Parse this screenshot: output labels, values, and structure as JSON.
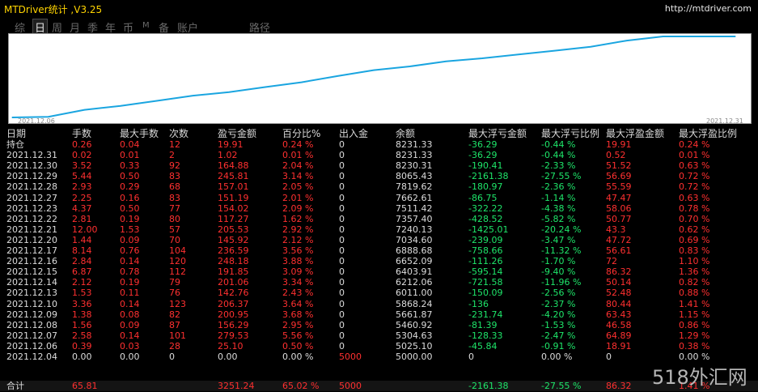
{
  "window": {
    "title": "MTDriver统计 ,V3.25",
    "url": "http://mtdriver.com"
  },
  "tabs": [
    {
      "label": "综",
      "active": false
    },
    {
      "label": "日",
      "active": true
    },
    {
      "label": "周",
      "active": false
    },
    {
      "label": "月",
      "active": false
    },
    {
      "label": "季",
      "active": false
    },
    {
      "label": "年",
      "active": false
    },
    {
      "label": "币",
      "active": false
    },
    {
      "label": "M",
      "active": false
    },
    {
      "label": "备",
      "active": false
    },
    {
      "label": "账户",
      "active": false
    },
    {
      "label": "路径",
      "active": false
    }
  ],
  "chart_data": {
    "type": "line",
    "x_start_label": "2021.12.06",
    "x_end_label": "2021.12.31",
    "line_color": "#1aa5e0",
    "series": [
      {
        "x": [
          "2021.12.04",
          "2021.12.06",
          "2021.12.07",
          "2021.12.08",
          "2021.12.09",
          "2021.12.10",
          "2021.12.13",
          "2021.12.14",
          "2021.12.15",
          "2021.12.16",
          "2021.12.17",
          "2021.12.20",
          "2021.12.21",
          "2021.12.22",
          "2021.12.23",
          "2021.12.27",
          "2021.12.28",
          "2021.12.29",
          "2021.12.30",
          "2021.12.31",
          "持仓"
        ],
        "values": [
          5000.0,
          5025.1,
          5304.63,
          5460.92,
          5661.87,
          5868.24,
          6011.0,
          6212.06,
          6403.91,
          6652.09,
          6888.68,
          7034.6,
          7240.13,
          7357.4,
          7511.42,
          7662.61,
          7819.62,
          8065.43,
          8230.31,
          8231.33,
          8231.33
        ]
      }
    ]
  },
  "columns": [
    "日期",
    "手数",
    "最大手数",
    "次数",
    "盈亏金额",
    "百分比%",
    "出入金",
    "余额",
    "最大浮亏金额",
    "最大浮亏比例",
    "最大浮盈金额",
    "最大浮盈比例"
  ],
  "rows": [
    [
      "持仓",
      "0.26",
      "0.04",
      "12",
      "19.91",
      "0.24 %",
      "0",
      "8231.33",
      "-36.29",
      "-0.44 %",
      "19.91",
      "0.24 %"
    ],
    [
      "2021.12.31",
      "0.02",
      "0.01",
      "2",
      "1.02",
      "0.01 %",
      "0",
      "8231.33",
      "-36.29",
      "-0.44 %",
      "0.52",
      "0.01 %"
    ],
    [
      "2021.12.30",
      "3.52",
      "0.33",
      "92",
      "164.88",
      "2.04 %",
      "0",
      "8230.31",
      "-190.41",
      "-2.33 %",
      "51.52",
      "0.63 %"
    ],
    [
      "2021.12.29",
      "5.44",
      "0.50",
      "83",
      "245.81",
      "3.14 %",
      "0",
      "8065.43",
      "-2161.38",
      "-27.55 %",
      "56.69",
      "0.72 %"
    ],
    [
      "2021.12.28",
      "2.93",
      "0.29",
      "68",
      "157.01",
      "2.05 %",
      "0",
      "7819.62",
      "-180.97",
      "-2.36 %",
      "55.59",
      "0.72 %"
    ],
    [
      "2021.12.27",
      "2.25",
      "0.16",
      "83",
      "151.19",
      "2.01 %",
      "0",
      "7662.61",
      "-86.75",
      "-1.14 %",
      "47.47",
      "0.63 %"
    ],
    [
      "2021.12.23",
      "4.37",
      "0.50",
      "77",
      "154.02",
      "2.09 %",
      "0",
      "7511.42",
      "-322.22",
      "-4.38 %",
      "58.06",
      "0.78 %"
    ],
    [
      "2021.12.22",
      "2.81",
      "0.19",
      "80",
      "117.27",
      "1.62 %",
      "0",
      "7357.40",
      "-428.52",
      "-5.82 %",
      "50.77",
      "0.70 %"
    ],
    [
      "2021.12.21",
      "12.00",
      "1.53",
      "57",
      "205.53",
      "2.92 %",
      "0",
      "7240.13",
      "-1425.01",
      "-20.24 %",
      "43.3",
      "0.62 %"
    ],
    [
      "2021.12.20",
      "1.44",
      "0.09",
      "70",
      "145.92",
      "2.12 %",
      "0",
      "7034.60",
      "-239.09",
      "-3.47 %",
      "47.72",
      "0.69 %"
    ],
    [
      "2021.12.17",
      "8.14",
      "0.76",
      "104",
      "236.59",
      "3.56 %",
      "0",
      "6888.68",
      "-758.66",
      "-11.32 %",
      "56.61",
      "0.83 %"
    ],
    [
      "2021.12.16",
      "2.84",
      "0.14",
      "120",
      "248.18",
      "3.88 %",
      "0",
      "6652.09",
      "-111.26",
      "-1.70 %",
      "72",
      "1.10 %"
    ],
    [
      "2021.12.15",
      "6.87",
      "0.78",
      "112",
      "191.85",
      "3.09 %",
      "0",
      "6403.91",
      "-595.14",
      "-9.40 %",
      "86.32",
      "1.36 %"
    ],
    [
      "2021.12.14",
      "2.12",
      "0.19",
      "79",
      "201.06",
      "3.34 %",
      "0",
      "6212.06",
      "-721.58",
      "-11.96 %",
      "50.14",
      "0.82 %"
    ],
    [
      "2021.12.13",
      "1.53",
      "0.11",
      "76",
      "142.76",
      "2.43 %",
      "0",
      "6011.00",
      "-150.09",
      "-2.56 %",
      "52.48",
      "0.88 %"
    ],
    [
      "2021.12.10",
      "3.36",
      "0.14",
      "123",
      "206.37",
      "3.64 %",
      "0",
      "5868.24",
      "-136",
      "-2.37 %",
      "80.44",
      "1.41 %"
    ],
    [
      "2021.12.09",
      "1.38",
      "0.08",
      "82",
      "200.95",
      "3.68 %",
      "0",
      "5661.87",
      "-231.74",
      "-4.20 %",
      "63.43",
      "1.15 %"
    ],
    [
      "2021.12.08",
      "1.56",
      "0.09",
      "87",
      "156.29",
      "2.95 %",
      "0",
      "5460.92",
      "-81.39",
      "-1.53 %",
      "46.58",
      "0.86 %"
    ],
    [
      "2021.12.07",
      "2.58",
      "0.14",
      "101",
      "279.53",
      "5.56 %",
      "0",
      "5304.63",
      "-128.33",
      "-2.47 %",
      "64.89",
      "1.29 %"
    ],
    [
      "2021.12.06",
      "0.39",
      "0.03",
      "28",
      "25.10",
      "0.50 %",
      "0",
      "5025.10",
      "-45.84",
      "-0.91 %",
      "18.91",
      "0.38 %"
    ],
    [
      "2021.12.04",
      "0.00",
      "0.00",
      "0",
      "0.00",
      "0.00 %",
      "5000",
      "5000.00",
      "0",
      "0.00 %",
      "0",
      "0.00 %"
    ]
  ],
  "total": [
    "合计",
    "65.81",
    "",
    "",
    "3251.24",
    "65.02 %",
    "5000",
    "",
    "-2161.38",
    "-27.55 %",
    "86.32",
    "1.41 %"
  ],
  "watermark": "518外汇网"
}
